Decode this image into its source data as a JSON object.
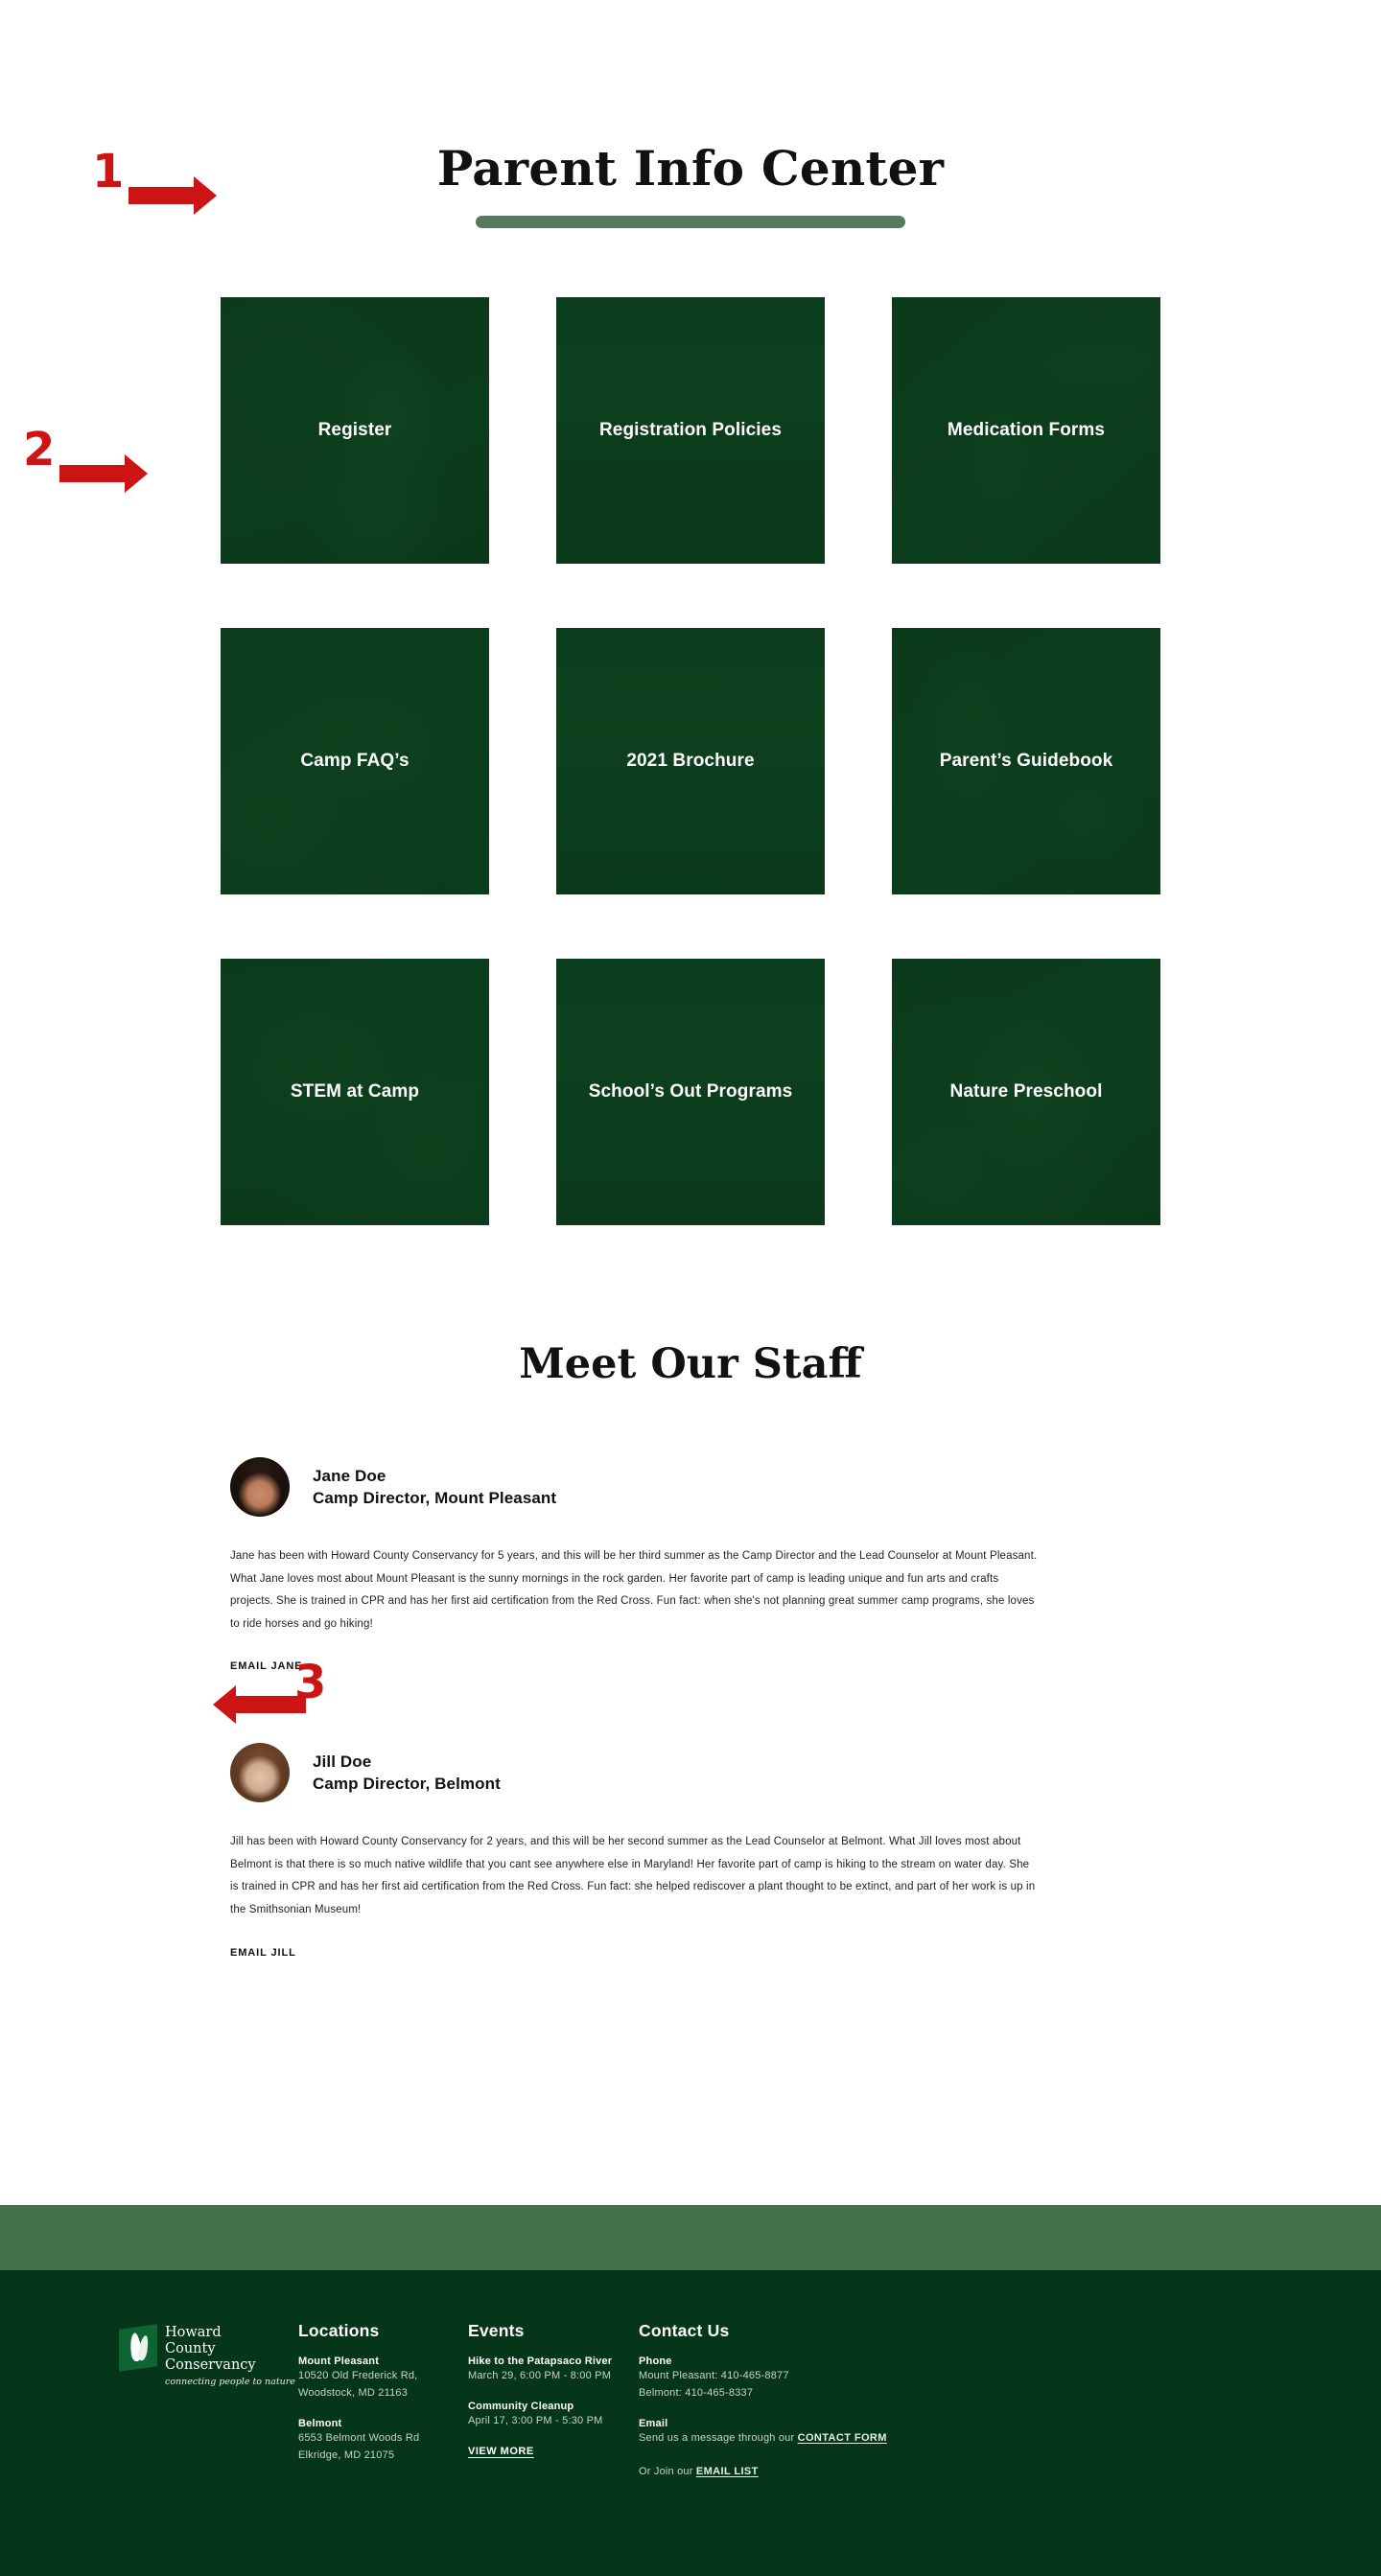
{
  "page": {
    "title": "Parent Info Center"
  },
  "tiles": [
    {
      "label": "Register",
      "photo": "ph-a"
    },
    {
      "label": "Registration Policies",
      "photo": "ph-b"
    },
    {
      "label": "Medication Forms",
      "photo": "ph-c"
    },
    {
      "label": "Camp FAQ’s",
      "photo": "ph-d"
    },
    {
      "label": "2021 Brochure",
      "photo": "ph-e"
    },
    {
      "label": "Parent’s Guidebook",
      "photo": "ph-f"
    },
    {
      "label": "STEM at Camp",
      "photo": "ph-g"
    },
    {
      "label": "School’s Out Programs",
      "photo": "ph-h"
    },
    {
      "label": "Nature Preschool",
      "photo": "ph-i"
    }
  ],
  "staff": {
    "heading": "Meet Our Staff",
    "members": [
      {
        "name": "Jane Doe",
        "role": "Camp Director, Mount Pleasant",
        "bio": "Jane has been with Howard County Conservancy for 5 years, and this will be her third summer as the Camp Director and the Lead Counselor at Mount Pleasant. What Jane loves most about Mount Pleasant is the sunny mornings in the rock garden. Her favorite part of camp is leading unique and fun arts and crafts projects. She is trained in CPR and has her first aid certification from the Red Cross. Fun fact: when she's not planning great summer camp programs, she loves to ride horses and go hiking!",
        "email_label": "EMAIL JANE"
      },
      {
        "name": "Jill Doe",
        "role": "Camp Director, Belmont",
        "bio": "Jill has been with Howard County Conservancy for 2 years, and this will be her second summer as the Lead Counselor at Belmont. What Jill loves most about Belmont is that there is so much native wildlife that you cant see anywhere else in Maryland! Her favorite part of camp is hiking to the stream on water day. She is trained in CPR and has her first aid certification from the Red Cross. Fun fact: she helped rediscover a plant thought to be extinct, and part of her work is up in the Smithsonian Museum!",
        "email_label": "EMAIL JILL"
      }
    ]
  },
  "footer": {
    "logo": {
      "line1": "Howard",
      "line2": "County",
      "line3": "Conservancy",
      "tagline": "connecting people to nature"
    },
    "locations": {
      "heading": "Locations",
      "items": [
        {
          "name": "Mount Pleasant",
          "address1": "10520 Old Frederick Rd,",
          "address2": "Woodstock, MD 21163"
        },
        {
          "name": "Belmont",
          "address1": "6553 Belmont Woods Rd",
          "address2": "Elkridge, MD 21075"
        }
      ]
    },
    "events": {
      "heading": "Events",
      "items": [
        {
          "name": "Hike to the Patapsaco River",
          "when": "March 29, 6:00 PM - 8:00 PM"
        },
        {
          "name": "Community Cleanup",
          "when": "April 17, 3:00 PM - 5:30 PM"
        }
      ],
      "view_more": "VIEW MORE"
    },
    "contact": {
      "heading": "Contact Us",
      "phone_label": "Phone",
      "phone_mount_pleasant": "Mount Pleasant: 410-465-8877",
      "phone_belmont": "Belmont: 410-465-8337",
      "email_label": "Email",
      "email_text_pre": "Send us a message through our ",
      "contact_form_link": "CONTACT FORM",
      "join_text_pre": "Or Join our ",
      "email_list_link": "EMAIL LIST"
    }
  },
  "annotations": [
    {
      "number": "1"
    },
    {
      "number": "2"
    },
    {
      "number": "3"
    }
  ],
  "colors": {
    "brand_dark_green": "#05361a",
    "brand_mid_green": "#44714a",
    "tile_green": "#0d3c1c",
    "annotation_red": "#cc1414",
    "underline_green": "#547a60"
  }
}
